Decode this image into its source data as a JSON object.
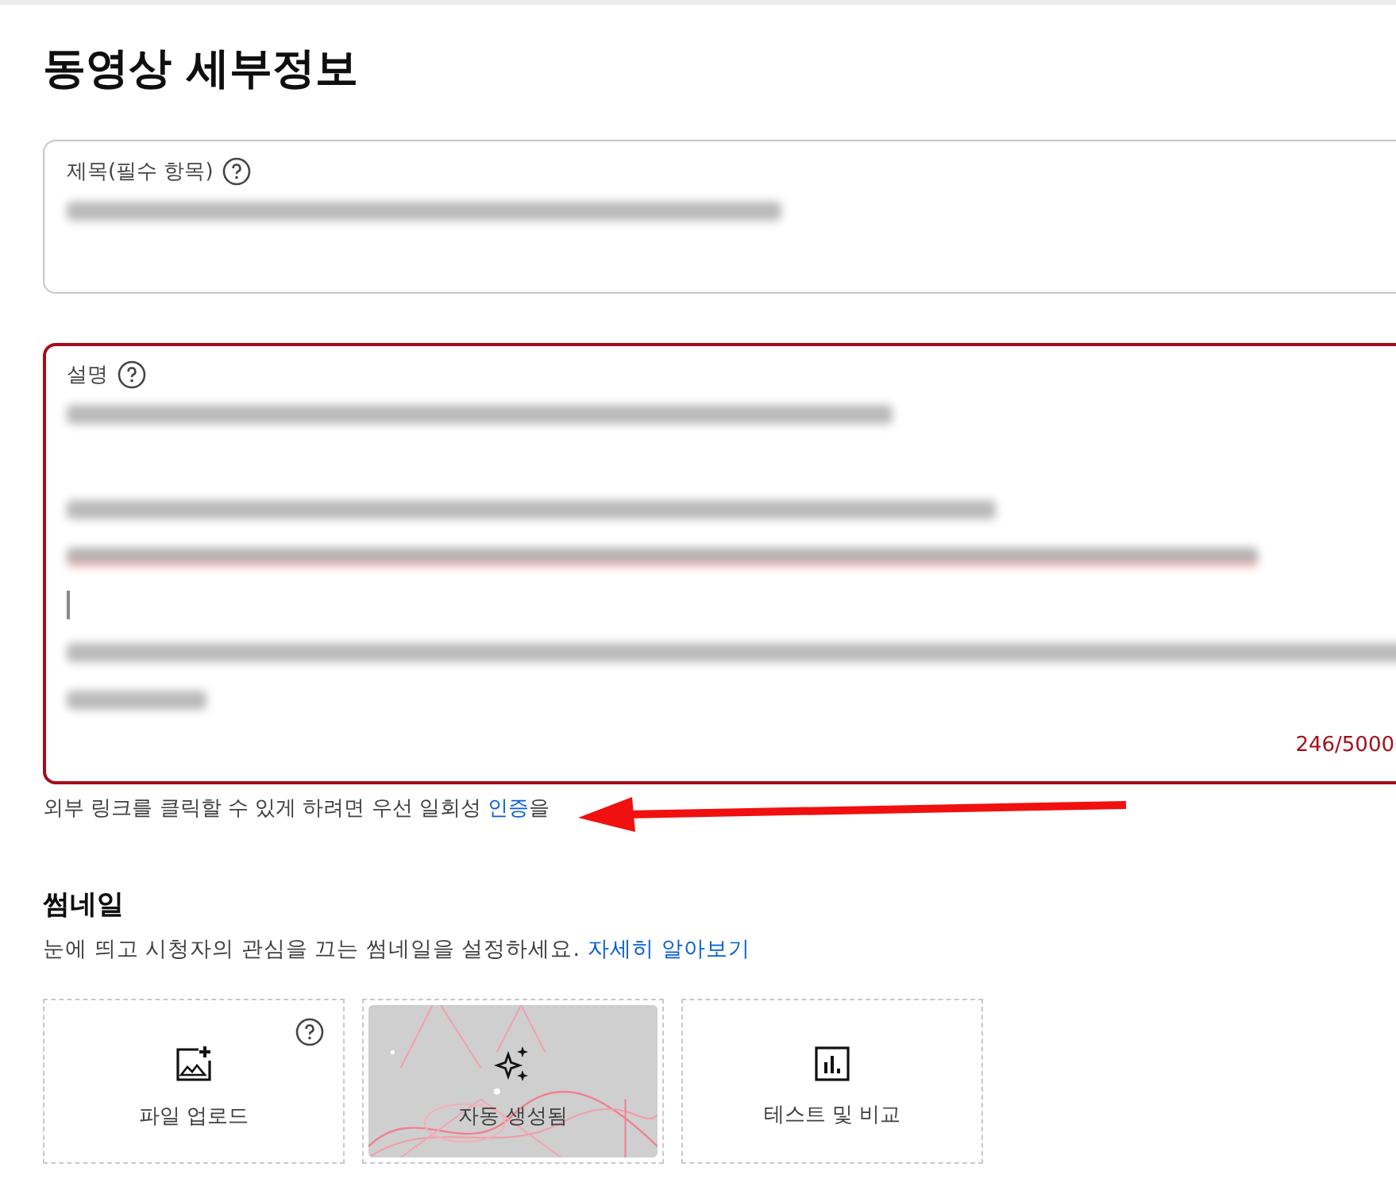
{
  "page_title": "동영상 세부정보",
  "title_field": {
    "label": "제목(필수 항목)",
    "focused": false,
    "lines": [
      {
        "kind": "blurred"
      }
    ]
  },
  "description_field": {
    "label": "설명",
    "focused": true,
    "counter": "246/5000",
    "lines": [
      {
        "kind": "blurred"
      },
      {
        "kind": "blank"
      },
      {
        "kind": "blurred"
      },
      {
        "kind": "blurred-link"
      },
      {
        "kind": "cursor"
      },
      {
        "kind": "blurred"
      },
      {
        "kind": "blurred"
      }
    ]
  },
  "link_notice": {
    "text": "외부 링크를 클릭할 수 있게 하려면 우선 일회성",
    "link": "인증",
    "after": "을"
  },
  "thumbnail": {
    "heading": "썸네일",
    "description": "눈에 띄고 시청자의 관심을 끄는 썸네일을 설정하세요.",
    "link": "자세히 알아보기",
    "options": [
      {
        "kind": "upload",
        "label": "파일 업로드"
      },
      {
        "kind": "auto",
        "label": "자동 생성됨"
      },
      {
        "kind": "test",
        "label": "테스트 및 비교"
      }
    ]
  }
}
